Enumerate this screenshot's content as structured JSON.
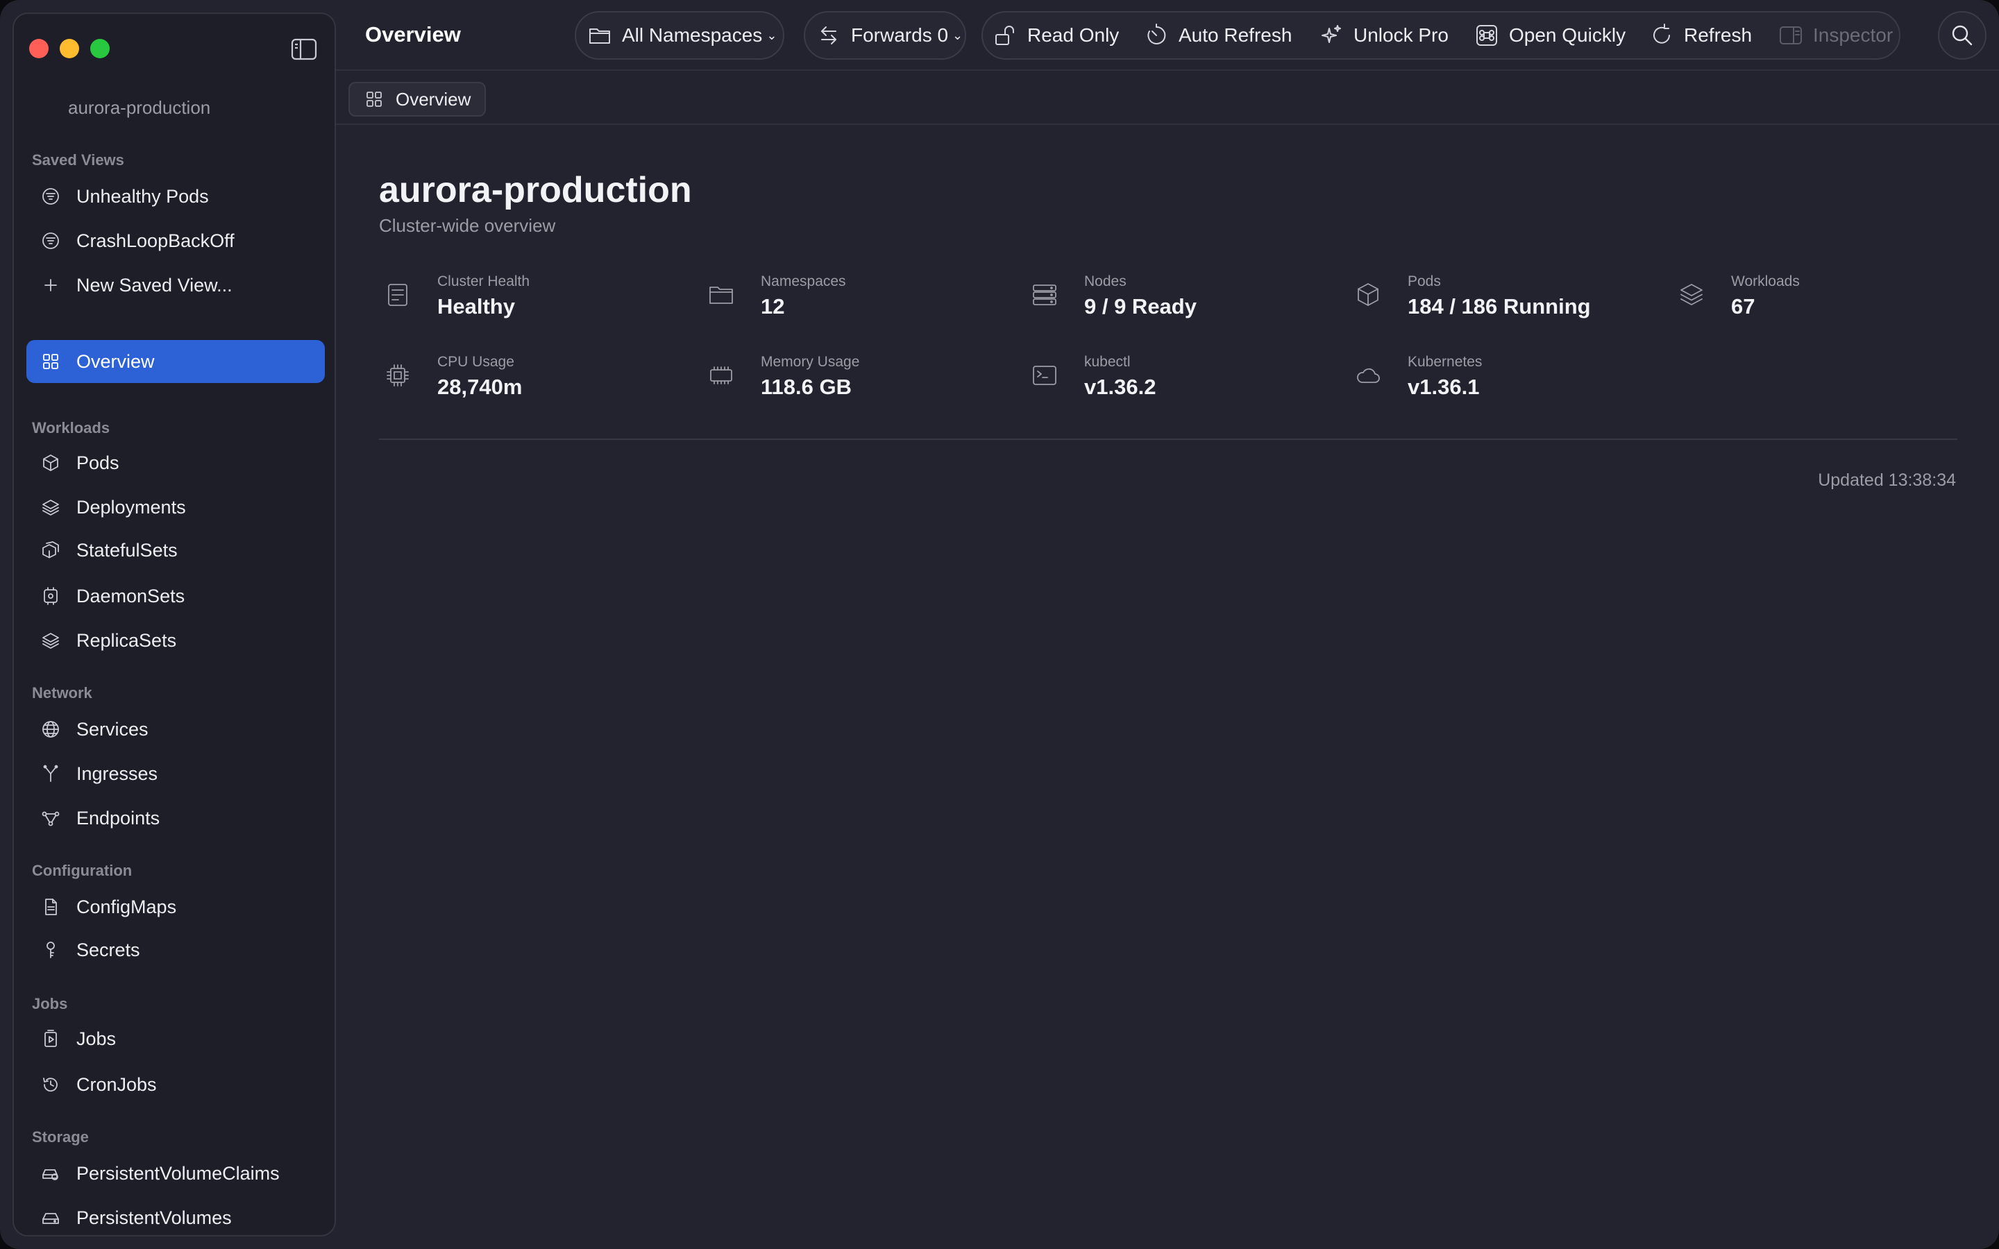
{
  "window": {
    "title": "Overview"
  },
  "sidebar": {
    "cluster_name": "aurora-production",
    "sections": {
      "saved_views": "Saved Views",
      "workloads": "Workloads",
      "network": "Network",
      "configuration": "Configuration",
      "jobs": "Jobs",
      "storage": "Storage"
    },
    "items": {
      "unhealthy_pods": "Unhealthy Pods",
      "crashloop": "CrashLoopBackOff",
      "new_saved_view": "New Saved View...",
      "overview": "Overview",
      "pods": "Pods",
      "deployments": "Deployments",
      "statefulsets": "StatefulSets",
      "daemonsets": "DaemonSets",
      "replicasets": "ReplicaSets",
      "services": "Services",
      "ingresses": "Ingresses",
      "endpoints": "Endpoints",
      "configmaps": "ConfigMaps",
      "secrets": "Secrets",
      "jobs": "Jobs",
      "cronjobs": "CronJobs",
      "pvcs": "PersistentVolumeClaims",
      "pvs": "PersistentVolumes"
    },
    "active_item": "Overview"
  },
  "toolbar": {
    "namespace_select": "All Namespaces",
    "forwards": "Forwards 0",
    "read_only": "Read Only",
    "auto_refresh": "Auto Refresh",
    "unlock_pro": "Unlock Pro",
    "open_quickly": "Open Quickly",
    "refresh": "Refresh",
    "inspector": "Inspector"
  },
  "tabs": [
    {
      "label": "Overview"
    }
  ],
  "main": {
    "title": "aurora-production",
    "subtitle": "Cluster-wide overview",
    "stats": {
      "cluster_health": {
        "label": "Cluster Health",
        "value": "Healthy",
        "icon": "health-card-icon"
      },
      "namespaces": {
        "label": "Namespaces",
        "value": "12",
        "icon": "folder-icon"
      },
      "nodes": {
        "label": "Nodes",
        "value": "9 / 9 Ready",
        "icon": "server-icon"
      },
      "pods": {
        "label": "Pods",
        "value": "184 / 186 Running",
        "icon": "cube-icon"
      },
      "workloads": {
        "label": "Workloads",
        "value": "67",
        "icon": "layers-icon"
      },
      "cpu": {
        "label": "CPU Usage",
        "value": "28,740m",
        "icon": "cpu-icon"
      },
      "memory": {
        "label": "Memory Usage",
        "value": "118.6 GB",
        "icon": "memory-icon"
      },
      "kubectl": {
        "label": "kubectl",
        "value": "v1.36.2",
        "icon": "terminal-icon"
      },
      "kubernetes": {
        "label": "Kubernetes",
        "value": "v1.36.1",
        "icon": "cloud-icon"
      }
    },
    "updated": "Updated 13:38:34"
  },
  "colors": {
    "window_bg": "#22232f",
    "sidebar_bg": "#1d1e27",
    "accent": "#2d62d6",
    "close": "#ff5f57",
    "minimize": "#febc2e",
    "zoom": "#28c840"
  }
}
